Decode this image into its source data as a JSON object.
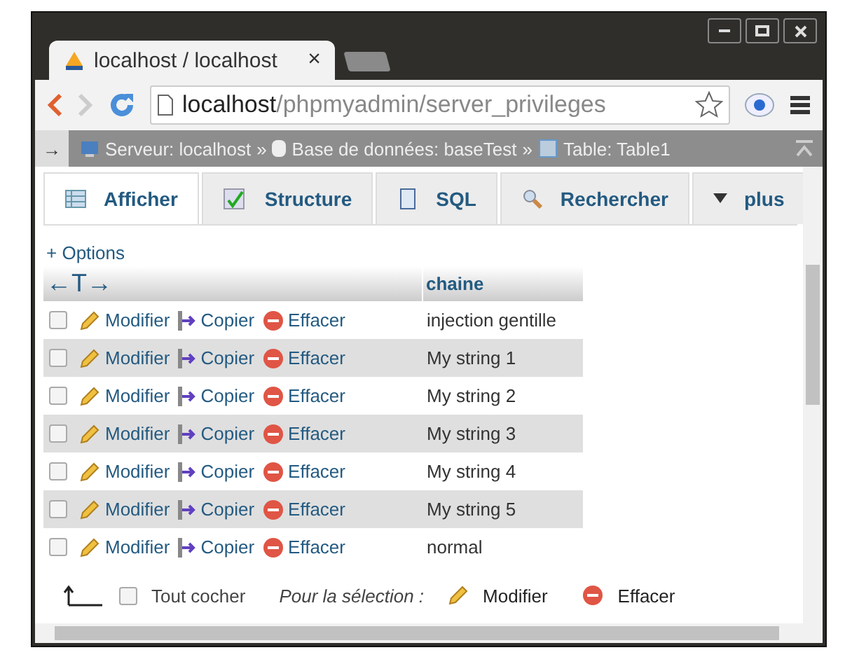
{
  "browser_tab": {
    "title": "localhost / localhost",
    "close": "×"
  },
  "address": {
    "host": "localhost",
    "path": "/phpmyadmin/server_privileges"
  },
  "breadcrumb": {
    "toggle": "→",
    "items": [
      {
        "kind": "server",
        "label": "Serveur: localhost"
      },
      {
        "kind": "database",
        "label": "Base de données: baseTest"
      },
      {
        "kind": "table",
        "label": "Table: Table1"
      }
    ],
    "separator": "»"
  },
  "tabs": [
    {
      "kind": "browse",
      "label": "Afficher",
      "selected": true
    },
    {
      "kind": "structure",
      "label": "Structure",
      "selected": false
    },
    {
      "kind": "sql",
      "label": "SQL",
      "selected": false
    },
    {
      "kind": "search",
      "label": "Rechercher",
      "selected": false
    },
    {
      "kind": "more",
      "label": "plus",
      "selected": false
    }
  ],
  "options_link": "+ Options",
  "table": {
    "arrows": "←T→",
    "columns": [
      "chaine"
    ],
    "rows": [
      {
        "checked": false,
        "edit": "Modifier",
        "copy": "Copier",
        "delete": "Effacer",
        "chaine": "injection gentille"
      },
      {
        "checked": false,
        "edit": "Modifier",
        "copy": "Copier",
        "delete": "Effacer",
        "chaine": "My string 1"
      },
      {
        "checked": false,
        "edit": "Modifier",
        "copy": "Copier",
        "delete": "Effacer",
        "chaine": "My string 2"
      },
      {
        "checked": false,
        "edit": "Modifier",
        "copy": "Copier",
        "delete": "Effacer",
        "chaine": "My string 3"
      },
      {
        "checked": false,
        "edit": "Modifier",
        "copy": "Copier",
        "delete": "Effacer",
        "chaine": "My string 4"
      },
      {
        "checked": false,
        "edit": "Modifier",
        "copy": "Copier",
        "delete": "Effacer",
        "chaine": "My string 5"
      },
      {
        "checked": false,
        "edit": "Modifier",
        "copy": "Copier",
        "delete": "Effacer",
        "chaine": "normal"
      }
    ]
  },
  "footer": {
    "check_all": {
      "label": "Tout cocher",
      "checked": false
    },
    "with_selected": "Pour la sélection :",
    "edit": "Modifier",
    "delete": "Effacer"
  }
}
